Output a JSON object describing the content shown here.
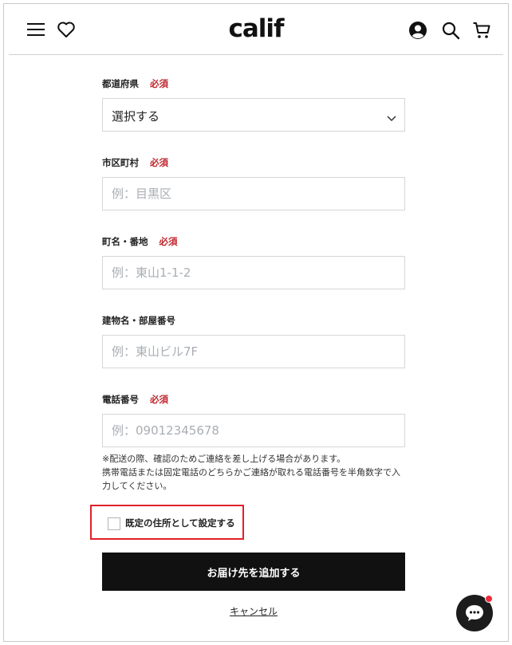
{
  "header": {
    "logo_text": "calif",
    "icons": [
      "menu-icon",
      "heart-icon",
      "account-icon",
      "search-icon",
      "cart-icon"
    ]
  },
  "form": {
    "prefecture": {
      "label": "都道府県",
      "required": "必須",
      "value": "選択する"
    },
    "city": {
      "label": "市区町村",
      "required": "必須",
      "placeholder": "例：目黒区"
    },
    "street": {
      "label": "町名・番地",
      "required": "必須",
      "placeholder": "例：東山1-1-2"
    },
    "building": {
      "label": "建物名・部屋番号",
      "placeholder": "例：東山ビル7F"
    },
    "phone": {
      "label": "電話番号",
      "required": "必須",
      "placeholder": "例：09012345678",
      "note_line1": "※配送の際、確認のためご連絡を差し上げる場合があります。",
      "note_line2": "携帯電話または固定電話のどちらかご連絡が取れる電話番号を半角数字で入力してください。"
    },
    "default_checkbox_label": "既定の住所として設定する",
    "submit_label": "お届け先を追加する",
    "cancel_label": "キャンセル"
  },
  "colors": {
    "required": "#c0262d",
    "button": "#111111",
    "highlight": "#e0202a",
    "chat_badge": "#ee2b3b"
  }
}
